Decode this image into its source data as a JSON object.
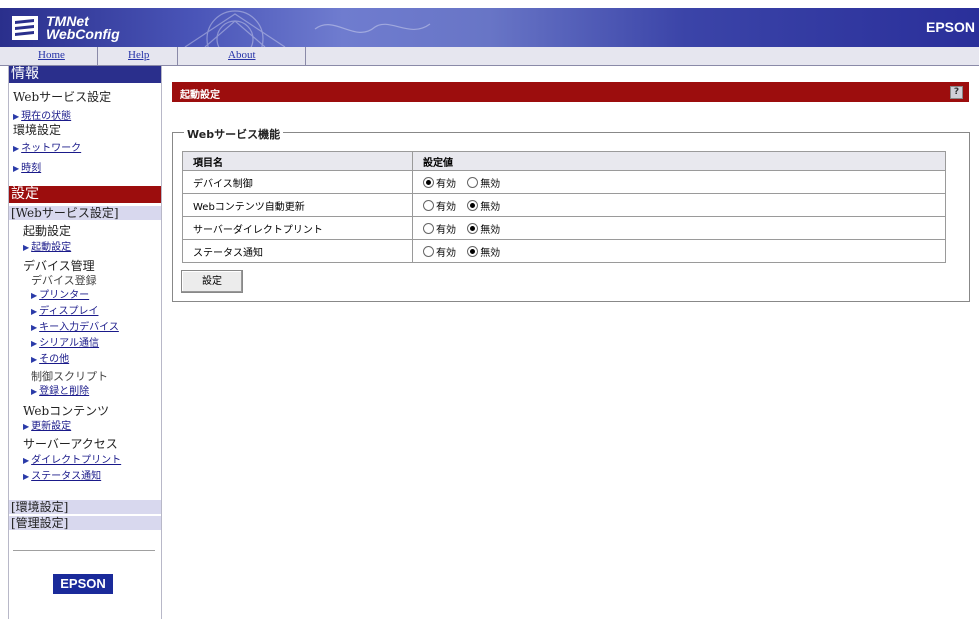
{
  "header": {
    "logo_line1": "TMNet",
    "logo_line2": "WebConfig",
    "brand": "EPSON"
  },
  "nav": {
    "home": "Home",
    "help": "Help",
    "about": "About"
  },
  "sidebar": {
    "info_title": "情報",
    "info_web_service": "Webサービス設定",
    "info_link_status": "現在の状態",
    "info_env": "環境設定",
    "info_link_network": "ネットワーク",
    "info_link_time": "時刻",
    "settings_title": "設定",
    "band_web_service": "[Webサービス設定]",
    "startup_head": "起動設定",
    "link_startup": "起動設定",
    "device_mgmt_head": "デバイス管理",
    "device_register_sub": "デバイス登録",
    "link_printer": "プリンター",
    "link_display": "ディスプレイ",
    "link_key_input": "キー入力デバイス",
    "link_serial": "シリアル通信",
    "link_other": "その他",
    "control_script_sub": "制御スクリプト",
    "link_register_delete": "登録と削除",
    "web_contents_head": "Webコンテンツ",
    "link_update": "更新設定",
    "server_access_head": "サーバーアクセス",
    "link_direct_print": "ダイレクトプリント",
    "link_status_notify": "ステータス通知",
    "band_env": "[環境設定]",
    "band_admin": "[管理設定]",
    "footer_brand": "EPSON"
  },
  "main": {
    "title": "起動設定",
    "help_icon": "?",
    "legend": "Webサービス機能",
    "col_name": "項目名",
    "col_value": "設定値",
    "option_on": "有効",
    "option_off": "無効",
    "rows": [
      {
        "name": "デバイス制御",
        "enabled": true
      },
      {
        "name": "Webコンテンツ自動更新",
        "enabled": false
      },
      {
        "name": "サーバーダイレクトプリント",
        "enabled": false
      },
      {
        "name": "ステータス通知",
        "enabled": false
      }
    ],
    "submit": "設定"
  },
  "colors": {
    "header_blue": "#2a2f8c",
    "section_red": "#9c0d0d",
    "band_lavender": "#d8d8ee"
  }
}
